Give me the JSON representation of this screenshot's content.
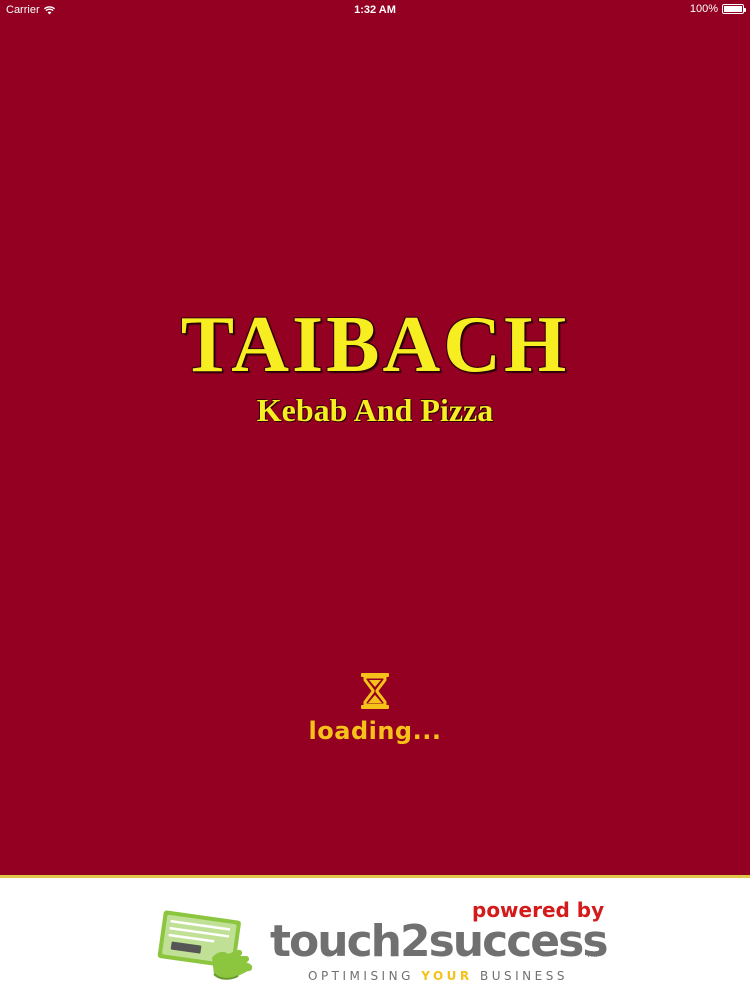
{
  "status_bar": {
    "carrier": "Carrier",
    "time": "1:32 AM",
    "battery_text": "100%",
    "battery_level": 1.0
  },
  "brand": {
    "title": "TAIBACH",
    "subtitle": "Kebab And Pizza"
  },
  "loader": {
    "icon": "hourglass-icon",
    "text": "loading..."
  },
  "footer": {
    "logo_icon": "touch-card-icon",
    "powered_by": "powered by",
    "wordmark": "touch2success",
    "trademark": "TM",
    "tagline_before": "OPTIMISING ",
    "tagline_highlight": "YOUR",
    "tagline_after": " BUSINESS"
  },
  "colors": {
    "background": "#930022",
    "title": "#f6ee21",
    "loading": "#f6c21a",
    "powered_by": "#d41b1b",
    "wordmark": "#707070",
    "logo_green": "#8cc63f"
  }
}
